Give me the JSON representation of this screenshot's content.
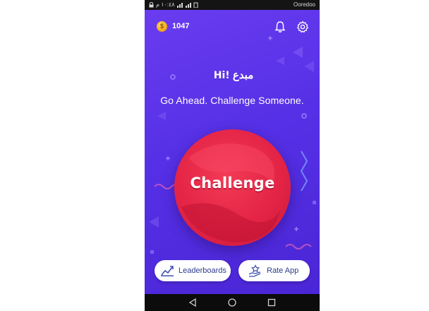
{
  "status_bar": {
    "time": "١٠:٤٨ م",
    "carrier": "Ooredoo"
  },
  "header": {
    "coins": "1047",
    "coin_icon": "coin-icon",
    "notification_icon": "bell-icon",
    "settings_icon": "gear-icon"
  },
  "greeting": {
    "name": "مبدع",
    "hi_badge": "Hi!"
  },
  "tagline": "Go Ahead. Challenge Someone.",
  "challenge_button": {
    "label": "Challenge"
  },
  "bottom_buttons": {
    "leaderboards": {
      "label": "Leaderboards",
      "icon": "leaderboard-icon"
    },
    "rate_app": {
      "label": "Rate App",
      "icon": "rate-hand-icon"
    }
  },
  "colors": {
    "background_top": "#6a3cf0",
    "background_bottom": "#4a26d6",
    "challenge_red": "#e42446",
    "pill_text": "#2c3a8c"
  }
}
